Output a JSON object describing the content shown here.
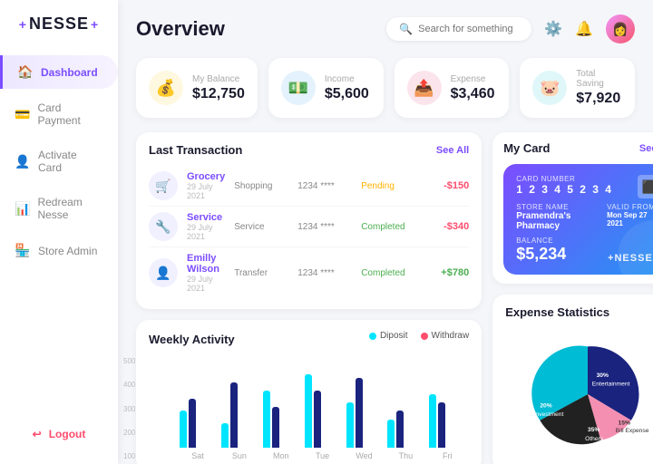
{
  "app": {
    "logo": "NESSE",
    "logo_plus_left": "+",
    "logo_plus_right": "+"
  },
  "sidebar": {
    "items": [
      {
        "id": "dashboard",
        "label": "Dashboard",
        "icon": "🏠",
        "active": true
      },
      {
        "id": "card-payment",
        "label": "Card Payment",
        "icon": "💳",
        "active": false
      },
      {
        "id": "activate-card",
        "label": "Activate Card",
        "icon": "👤",
        "active": false
      },
      {
        "id": "redream-nesse",
        "label": "Redream Nesse",
        "icon": "📊",
        "active": false
      },
      {
        "id": "store-admin",
        "label": "Store Admin",
        "icon": "🏪",
        "active": false
      }
    ],
    "logout_label": "Logout"
  },
  "header": {
    "title": "Overview",
    "search_placeholder": "Search for something"
  },
  "stats": [
    {
      "id": "balance",
      "label": "My Balance",
      "value": "$12,750",
      "icon": "💰",
      "color": "yellow"
    },
    {
      "id": "income",
      "label": "Income",
      "value": "$5,600",
      "icon": "💵",
      "color": "blue"
    },
    {
      "id": "expense",
      "label": "Expense",
      "value": "$3,460",
      "icon": "📤",
      "color": "pink"
    },
    {
      "id": "saving",
      "label": "Total Saving",
      "value": "$7,920",
      "icon": "🐷",
      "color": "teal"
    }
  ],
  "transactions": {
    "title": "Last Transaction",
    "see_all": "See All",
    "items": [
      {
        "name": "Grocery",
        "date": "29 July 2021",
        "type": "Shopping",
        "card": "1234 ****",
        "status": "Pending",
        "status_class": "pending",
        "amount": "-$150",
        "amount_class": "neg",
        "icon": "🛒"
      },
      {
        "name": "Service",
        "date": "29 July 2021",
        "type": "Service",
        "card": "1234 ****",
        "status": "Completed",
        "status_class": "completed",
        "amount": "-$340",
        "amount_class": "neg",
        "icon": "🔧"
      },
      {
        "name": "Emilly Wilson",
        "date": "29 July 2021",
        "type": "Transfer",
        "card": "1234 ****",
        "status": "Completed",
        "status_class": "completed",
        "amount": "+$780",
        "amount_class": "pos",
        "icon": "👤"
      }
    ]
  },
  "my_card": {
    "title": "My Card",
    "see_all": "See All",
    "card_number_label": "CARD NUMBER",
    "card_number": "1 2 3 4 5 2 3 4",
    "store_name_label": "STORE NAME",
    "store_name": "Pramendra's Pharmacy",
    "valid_from_label": "VALID FROM",
    "valid_from": "Mon Sep 27 2021",
    "balance_label": "BALANCE",
    "balance": "$5,234",
    "logo": "+NESSE+"
  },
  "weekly_activity": {
    "title": "Weekly Activity",
    "deposit_label": "Diposit",
    "withdraw_label": "Withdraw",
    "y_labels": [
      "500",
      "400",
      "300",
      "200",
      "100"
    ],
    "days": [
      "Sat",
      "Sun",
      "Mon",
      "Tue",
      "Wed",
      "Thu",
      "Fri"
    ],
    "bars": [
      {
        "day": "Sat",
        "deposit": 45,
        "withdraw": 60
      },
      {
        "day": "Sun",
        "deposit": 30,
        "withdraw": 80
      },
      {
        "day": "Mon",
        "deposit": 70,
        "withdraw": 50
      },
      {
        "day": "Tue",
        "deposit": 90,
        "withdraw": 70
      },
      {
        "day": "Wed",
        "deposit": 55,
        "withdraw": 85
      },
      {
        "day": "Thu",
        "deposit": 35,
        "withdraw": 45
      },
      {
        "day": "Fri",
        "deposit": 65,
        "withdraw": 55
      }
    ]
  },
  "expense_stats": {
    "title": "Expense Statistics",
    "segments": [
      {
        "label": "Entertainment",
        "percent": "30%",
        "color": "#1a237e"
      },
      {
        "label": "Bill Expense",
        "percent": "15%",
        "color": "#f48fb1"
      },
      {
        "label": "Investment",
        "percent": "20%",
        "color": "#00bcd4"
      },
      {
        "label": "Others",
        "percent": "35%",
        "color": "#212121"
      }
    ]
  }
}
